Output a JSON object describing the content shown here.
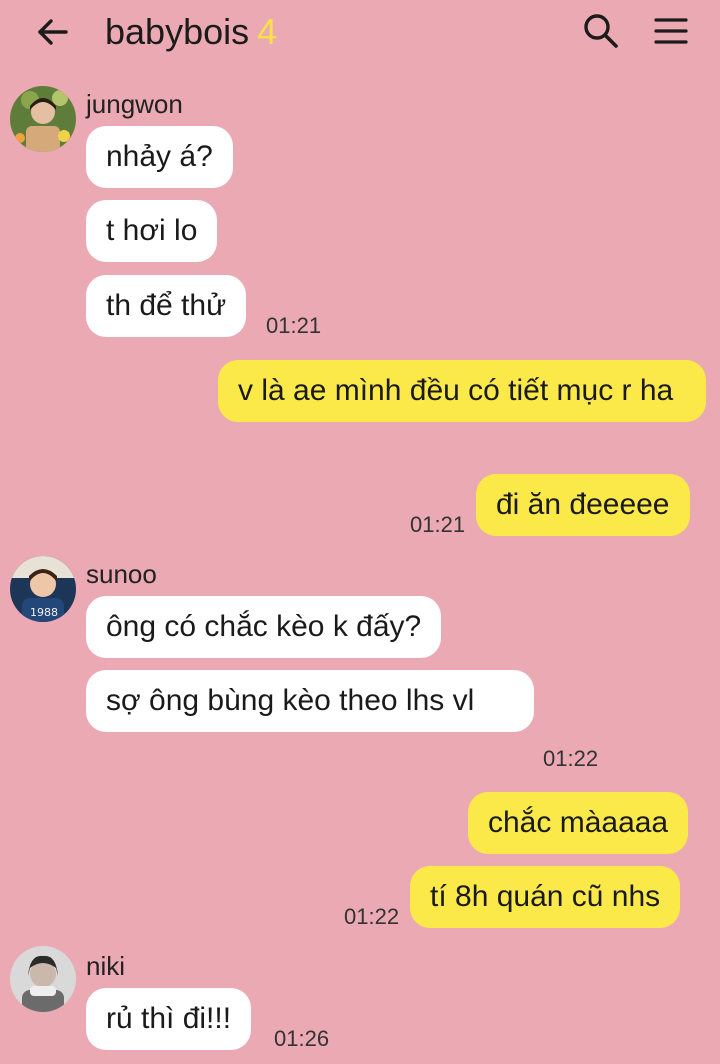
{
  "header": {
    "title": "babybois",
    "member_count": "4",
    "icons": [
      "back-arrow-icon",
      "search-icon",
      "menu-icon"
    ],
    "count_color": "#f8e04a"
  },
  "colors": {
    "background": "#eaa9b3",
    "incoming_bubble": "#ffffff",
    "outgoing_bubble": "#fbe94a"
  },
  "messages": {
    "jungwon": {
      "name": "jungwon",
      "texts": [
        "nhảy á?",
        "t hơi lo",
        "th để thử"
      ],
      "time": "01:21"
    },
    "me1": {
      "texts": [
        "v là ae mình đều có tiết mục r ha",
        "đi ăn đeeeee"
      ],
      "time": "01:21"
    },
    "sunoo": {
      "name": "sunoo",
      "texts": [
        "ông có chắc kèo k đấy?",
        "sợ ông bùng kèo theo lhs vl"
      ],
      "time": "01:22"
    },
    "me2": {
      "texts": [
        "chắc màaaaa",
        "tí 8h quán cũ nhs"
      ],
      "time": "01:22"
    },
    "niki": {
      "name": "niki",
      "texts": [
        "rủ thì đi!!!"
      ],
      "time": "01:26"
    }
  }
}
